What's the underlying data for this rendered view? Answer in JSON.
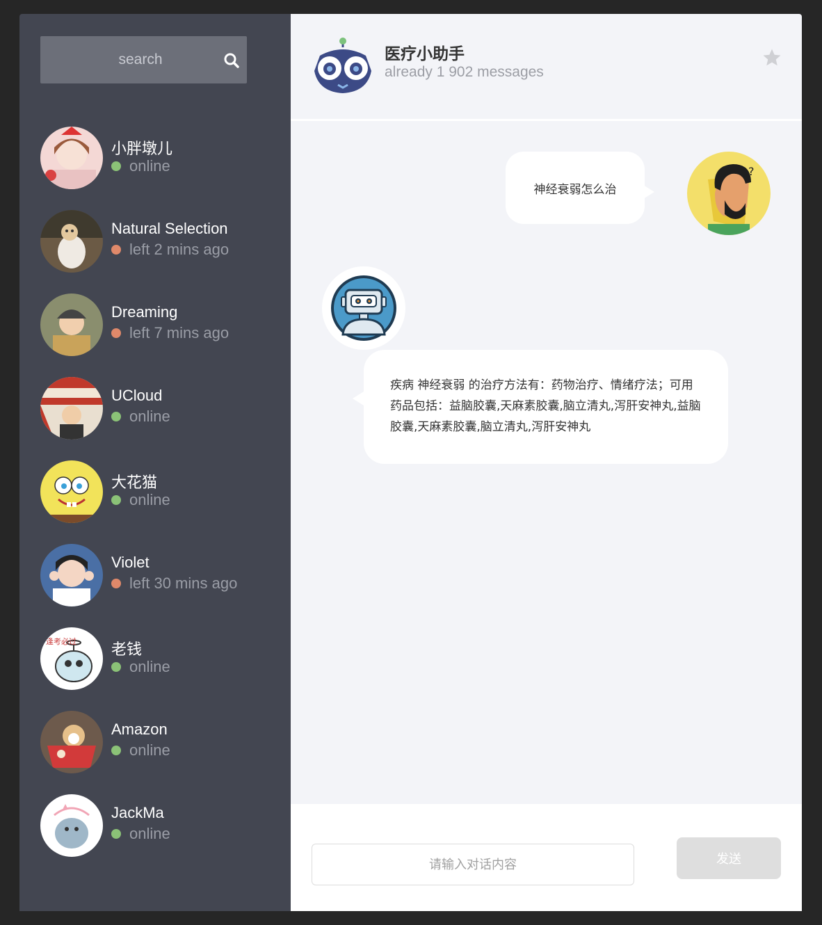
{
  "search": {
    "placeholder": "search",
    "icon": "search-icon"
  },
  "contacts": [
    {
      "name": "小胖墩儿",
      "status": "online",
      "status_color": "#8bc277"
    },
    {
      "name": "Natural Selection",
      "status": "left 2 mins ago",
      "status_color": "#e0896a"
    },
    {
      "name": "Dreaming",
      "status": "left 7 mins ago",
      "status_color": "#e0896a"
    },
    {
      "name": "UCloud",
      "status": "online",
      "status_color": "#8bc277"
    },
    {
      "name": "大花猫",
      "status": "online",
      "status_color": "#8bc277"
    },
    {
      "name": "Violet",
      "status": "left 30 mins ago",
      "status_color": "#e0896a"
    },
    {
      "name": "老钱",
      "status": "online",
      "status_color": "#8bc277"
    },
    {
      "name": "Amazon",
      "status": "online",
      "status_color": "#8bc277"
    },
    {
      "name": "JackMa",
      "status": "online",
      "status_color": "#8bc277"
    }
  ],
  "chat": {
    "title": "医疗小助手",
    "subtitle": "already 1 902 messages",
    "messages": [
      {
        "from": "user",
        "text": "神经衰弱怎么治"
      },
      {
        "from": "bot",
        "text": "疾病 神经衰弱 的治疗方法有：药物治疗、情绪疗法；可用药品包括：益脑胶囊,天麻素胶囊,脑立清丸,泻肝安神丸,益脑胶囊,天麻素胶囊,脑立清丸,泻肝安神丸"
      }
    ]
  },
  "composer": {
    "placeholder": "请输入对话内容",
    "send_label": "发送"
  },
  "colors": {
    "sidebar": "#434651",
    "main_bg": "#f3f4f8",
    "online": "#8bc277",
    "away": "#e0896a"
  }
}
